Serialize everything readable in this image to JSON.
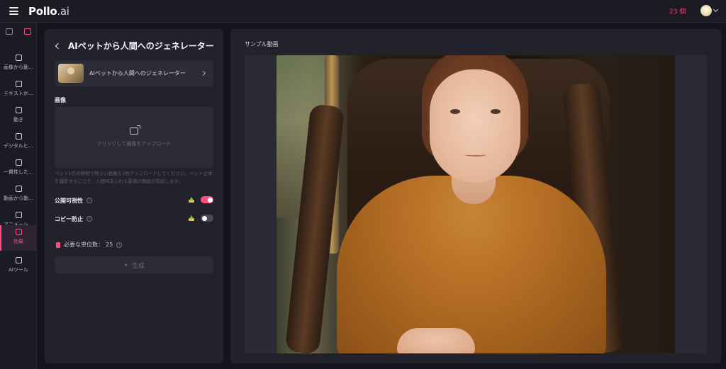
{
  "header": {
    "logo_main": "Pollo",
    "logo_suffix": ".ai",
    "credits": "23 個"
  },
  "sidebar": {
    "items": [
      {
        "label": "画像から動…",
        "icon": "image-to-video-icon"
      },
      {
        "label": "テキストか…",
        "icon": "text-to-video-icon"
      },
      {
        "label": "動き",
        "icon": "motion-icon"
      },
      {
        "label": "デジタルヒ…",
        "icon": "digital-human-icon"
      },
      {
        "label": "一貫性した…",
        "icon": "consistency-icon"
      },
      {
        "label": "動画から動…",
        "icon": "video-to-video-icon"
      },
      {
        "label": "アニメーシ…",
        "icon": "animation-icon"
      },
      {
        "label": "効果",
        "icon": "effects-icon"
      },
      {
        "label": "AIツール",
        "icon": "ai-tools-icon"
      }
    ],
    "active_index": 7
  },
  "panel": {
    "title": "AIペットから人間へのジェネレーター",
    "model_card_label": "AIペットから人間へのジェネレーター",
    "image_section_label": "画像",
    "upload_text": "クリックして画像をアップロード",
    "hint": "ペット1匹の鮮明で明るい画像を1枚アップロードしてください。ペット全体を撮影することで、人間味あふれる最適の動画が完成します。",
    "public_visibility_label": "公開可視性",
    "public_visibility_on": true,
    "copy_protect_label": "コピー防止",
    "copy_protect_on": false,
    "cost_label": "必要な単位数：",
    "cost_value": "25",
    "generate_label": "生成"
  },
  "preview": {
    "label": "サンプル動画"
  },
  "colors": {
    "accent": "#ff4f7d",
    "background": "#14141c",
    "panel": "#22222c"
  }
}
